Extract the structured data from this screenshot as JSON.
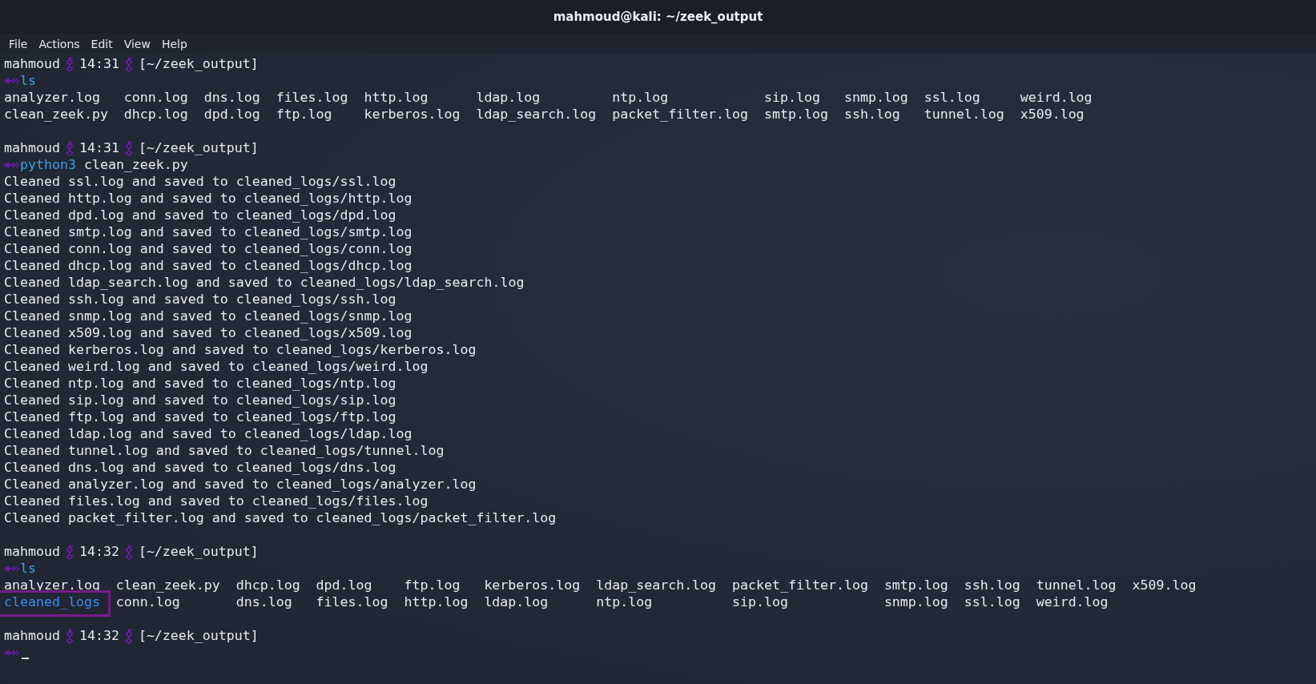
{
  "window": {
    "title": "mahmoud@kali: ~/zeek_output"
  },
  "menu": [
    "File",
    "Actions",
    "Edit",
    "View",
    "Help"
  ],
  "blocks": [
    {
      "prompt": {
        "user": "mahmoud",
        "time": "14:31",
        "path": "[~/zeek_output]"
      },
      "command": {
        "name": "ls"
      },
      "output": {
        "kind": "grid",
        "rows": [
          [
            {
              "name": "analyzer.log",
              "kind": "file",
              "highlighted": false
            },
            {
              "name": "conn.log",
              "kind": "file",
              "highlighted": false
            },
            {
              "name": "dns.log",
              "kind": "file",
              "highlighted": false
            },
            {
              "name": "files.log",
              "kind": "file",
              "highlighted": false
            },
            {
              "name": "http.log",
              "kind": "file",
              "highlighted": false
            },
            {
              "name": "ldap.log",
              "kind": "file",
              "highlighted": false
            },
            {
              "name": "ntp.log",
              "kind": "file",
              "highlighted": false
            },
            {
              "name": "sip.log",
              "kind": "file",
              "highlighted": false
            },
            {
              "name": "snmp.log",
              "kind": "file",
              "highlighted": false
            },
            {
              "name": "ssl.log",
              "kind": "file",
              "highlighted": false
            },
            {
              "name": "weird.log",
              "kind": "file",
              "highlighted": false
            }
          ],
          [
            {
              "name": "clean_zeek.py",
              "kind": "file",
              "highlighted": false
            },
            {
              "name": "dhcp.log",
              "kind": "file",
              "highlighted": false
            },
            {
              "name": "dpd.log",
              "kind": "file",
              "highlighted": false
            },
            {
              "name": "ftp.log",
              "kind": "file",
              "highlighted": false
            },
            {
              "name": "kerberos.log",
              "kind": "file",
              "highlighted": false
            },
            {
              "name": "ldap_search.log",
              "kind": "file",
              "highlighted": false
            },
            {
              "name": "packet_filter.log",
              "kind": "file",
              "highlighted": false
            },
            {
              "name": "smtp.log",
              "kind": "file",
              "highlighted": false
            },
            {
              "name": "ssh.log",
              "kind": "file",
              "highlighted": false
            },
            {
              "name": "tunnel.log",
              "kind": "file",
              "highlighted": false
            },
            {
              "name": "x509.log",
              "kind": "file",
              "highlighted": false
            }
          ]
        ]
      }
    },
    {
      "prompt": {
        "user": "mahmoud",
        "time": "14:31",
        "path": "[~/zeek_output]"
      },
      "command": {
        "name": "python3",
        "args": "clean_zeek.py"
      },
      "output": {
        "kind": "lines",
        "lines": [
          "Cleaned ssl.log and saved to cleaned_logs/ssl.log",
          "Cleaned http.log and saved to cleaned_logs/http.log",
          "Cleaned dpd.log and saved to cleaned_logs/dpd.log",
          "Cleaned smtp.log and saved to cleaned_logs/smtp.log",
          "Cleaned conn.log and saved to cleaned_logs/conn.log",
          "Cleaned dhcp.log and saved to cleaned_logs/dhcp.log",
          "Cleaned ldap_search.log and saved to cleaned_logs/ldap_search.log",
          "Cleaned ssh.log and saved to cleaned_logs/ssh.log",
          "Cleaned snmp.log and saved to cleaned_logs/snmp.log",
          "Cleaned x509.log and saved to cleaned_logs/x509.log",
          "Cleaned kerberos.log and saved to cleaned_logs/kerberos.log",
          "Cleaned weird.log and saved to cleaned_logs/weird.log",
          "Cleaned ntp.log and saved to cleaned_logs/ntp.log",
          "Cleaned sip.log and saved to cleaned_logs/sip.log",
          "Cleaned ftp.log and saved to cleaned_logs/ftp.log",
          "Cleaned ldap.log and saved to cleaned_logs/ldap.log",
          "Cleaned tunnel.log and saved to cleaned_logs/tunnel.log",
          "Cleaned dns.log and saved to cleaned_logs/dns.log",
          "Cleaned analyzer.log and saved to cleaned_logs/analyzer.log",
          "Cleaned files.log and saved to cleaned_logs/files.log",
          "Cleaned packet_filter.log and saved to cleaned_logs/packet_filter.log"
        ]
      }
    },
    {
      "prompt": {
        "user": "mahmoud",
        "time": "14:32",
        "path": "[~/zeek_output]"
      },
      "command": {
        "name": "ls"
      },
      "output": {
        "kind": "grid",
        "rows": [
          [
            {
              "name": "analyzer.log",
              "kind": "file",
              "highlighted": false
            },
            {
              "name": "clean_zeek.py",
              "kind": "file",
              "highlighted": false
            },
            {
              "name": "dhcp.log",
              "kind": "file",
              "highlighted": false
            },
            {
              "name": "dpd.log",
              "kind": "file",
              "highlighted": false
            },
            {
              "name": "ftp.log",
              "kind": "file",
              "highlighted": false
            },
            {
              "name": "kerberos.log",
              "kind": "file",
              "highlighted": false
            },
            {
              "name": "ldap_search.log",
              "kind": "file",
              "highlighted": false
            },
            {
              "name": "packet_filter.log",
              "kind": "file",
              "highlighted": false
            },
            {
              "name": "smtp.log",
              "kind": "file",
              "highlighted": false
            },
            {
              "name": "ssh.log",
              "kind": "file",
              "highlighted": false
            },
            {
              "name": "tunnel.log",
              "kind": "file",
              "highlighted": false
            },
            {
              "name": "x509.log",
              "kind": "file",
              "highlighted": false
            }
          ],
          [
            {
              "name": "cleaned_logs",
              "kind": "dir",
              "highlighted": true
            },
            {
              "name": "conn.log",
              "kind": "file",
              "highlighted": false
            },
            {
              "name": "dns.log",
              "kind": "file",
              "highlighted": false
            },
            {
              "name": "files.log",
              "kind": "file",
              "highlighted": false
            },
            {
              "name": "http.log",
              "kind": "file",
              "highlighted": false
            },
            {
              "name": "ldap.log",
              "kind": "file",
              "highlighted": false
            },
            {
              "name": "ntp.log",
              "kind": "file",
              "highlighted": false
            },
            {
              "name": "sip.log",
              "kind": "file",
              "highlighted": false
            },
            {
              "name": "snmp.log",
              "kind": "file",
              "highlighted": false
            },
            {
              "name": "ssl.log",
              "kind": "file",
              "highlighted": false
            },
            {
              "name": "weird.log",
              "kind": "file",
              "highlighted": false
            }
          ]
        ]
      }
    },
    {
      "prompt": {
        "user": "mahmoud",
        "time": "14:32",
        "path": "[~/zeek_output]"
      },
      "cursor": true
    }
  ]
}
